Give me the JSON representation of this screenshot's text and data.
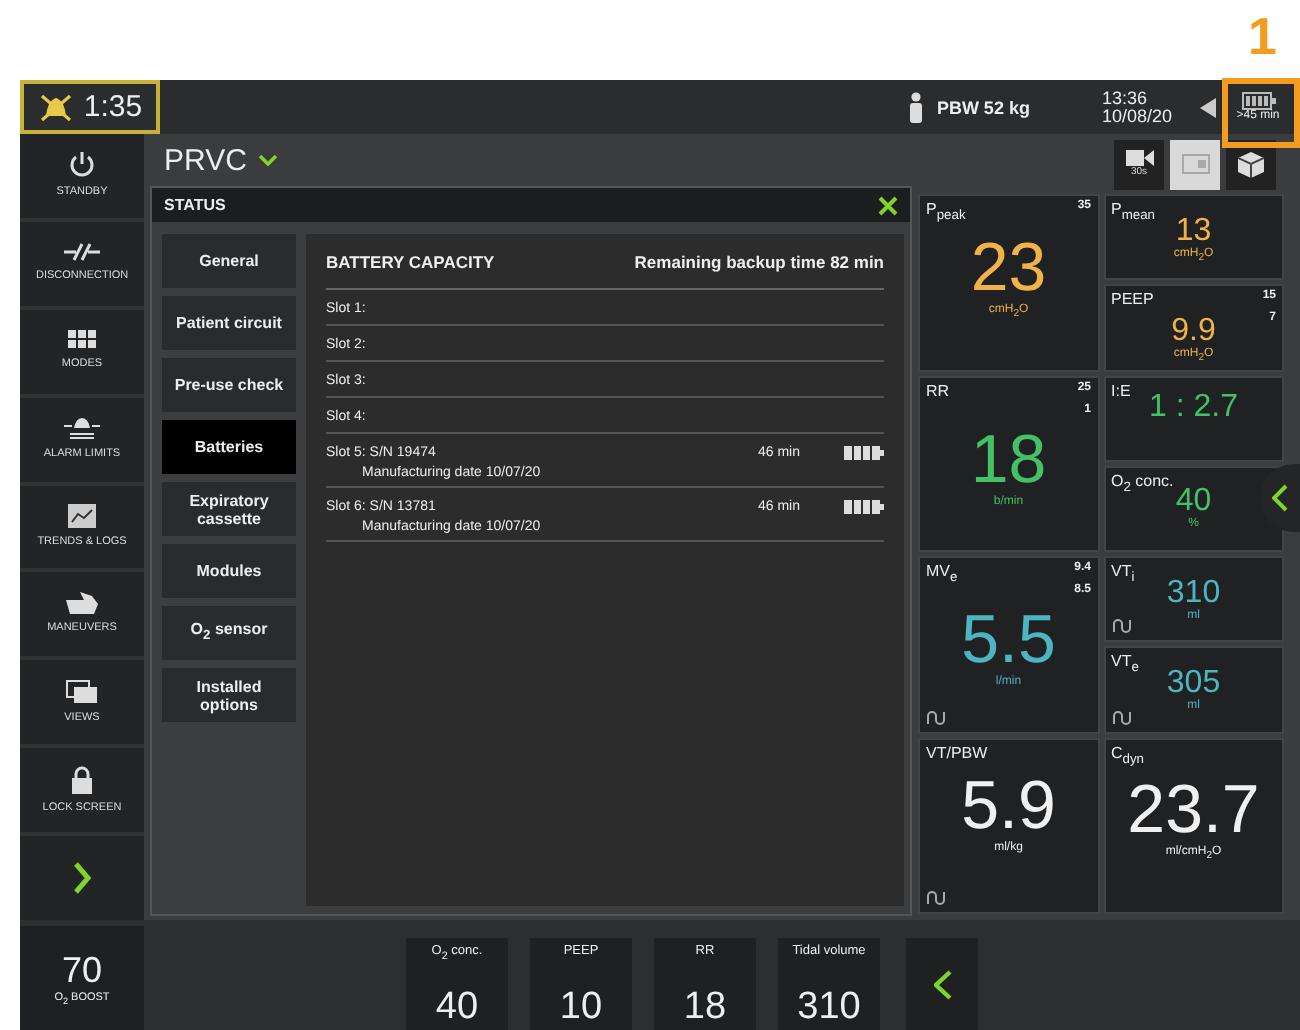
{
  "annotation": {
    "label": "1"
  },
  "top_bar": {
    "alarm_timer": "1:35",
    "patient": "PBW 52 kg",
    "time": "13:36",
    "date": "10/08/20",
    "battery": ">45 min"
  },
  "sidebar": {
    "items": [
      {
        "kind": "standby",
        "label": "STANDBY"
      },
      {
        "kind": "disconnection",
        "label": "DISCONNECTION"
      },
      {
        "kind": "modes",
        "label": "MODES"
      },
      {
        "kind": "alarm_limits",
        "label": "ALARM LIMITS"
      },
      {
        "kind": "trends",
        "label": "TRENDS & LOGS"
      },
      {
        "kind": "maneuvers",
        "label": "MANEUVERS"
      },
      {
        "kind": "views",
        "label": "VIEWS"
      },
      {
        "kind": "lock",
        "label": "LOCK SCREEN"
      },
      {
        "kind": "expand"
      }
    ]
  },
  "mode": "PRVC",
  "view_buttons": [
    {
      "kind": "record",
      "label": "30s",
      "selected": false
    },
    {
      "kind": "tile",
      "selected": true
    },
    {
      "kind": "cube",
      "selected": false
    }
  ],
  "status": {
    "title": "STATUS",
    "tabs": [
      {
        "label": "General",
        "selected": false
      },
      {
        "label": "Patient circuit",
        "selected": false
      },
      {
        "label": "Pre-use check",
        "selected": false
      },
      {
        "label": "Batteries",
        "selected": true
      },
      {
        "label": "Expiratory cassette",
        "selected": false
      },
      {
        "label": "Modules",
        "selected": false
      },
      {
        "label": "O$_{2}$ sensor",
        "selected": false
      },
      {
        "label": "Installed options",
        "selected": false
      }
    ],
    "heading": "BATTERY CAPACITY",
    "remaining": "Remaining backup time 82 min",
    "slots": [
      {
        "label": "Slot 1:"
      },
      {
        "label": "Slot 2:"
      },
      {
        "label": "Slot 3:"
      },
      {
        "label": "Slot 4:"
      },
      {
        "label": "Slot 5: S/N 19474",
        "time": "46 min",
        "date": "Manufacturing date 10/07/20"
      },
      {
        "label": "Slot 6: S/N 13781",
        "time": "46 min",
        "date": "Manufacturing date 10/07/20"
      }
    ]
  },
  "metric_rows": [
    {
      "main": {
        "kind": "large",
        "name": "P$_{peak}$",
        "upper": "35",
        "value": "23",
        "unit": "cmH$_{2}$O",
        "color": "#f2b24a",
        "waveform": false
      },
      "side": [
        {
          "kind": "small",
          "name": "P$_{mean}$",
          "value": "13",
          "unit": "cmH$_{2}$O",
          "color": "#f2b24a",
          "waveform": false
        },
        {
          "kind": "small",
          "name": "PEEP",
          "upper": "15",
          "lower": "7",
          "value": "9.9",
          "unit": "cmH$_{2}$O",
          "color": "#f2b24a",
          "waveform": false
        }
      ]
    },
    {
      "main": {
        "kind": "large",
        "name": "RR",
        "upper": "25",
        "lower": "1",
        "value": "18",
        "unit": "b/min",
        "color": "#44c066",
        "waveform": false
      },
      "side": [
        {
          "kind": "small",
          "name": "I:E",
          "value": "1 : 2.7",
          "color": "#44c066",
          "waveform": false
        },
        {
          "kind": "small",
          "name": "O$_{2}$ conc.",
          "value": "40",
          "unit": "%",
          "color": "#44c066",
          "waveform": false
        }
      ]
    },
    {
      "main": {
        "kind": "large",
        "name": "MV$_{e}$",
        "upper": "9.4",
        "lower": "8.5",
        "value": "5.5",
        "unit": "l/min",
        "color": "#4db5c1",
        "waveform": true
      },
      "side": [
        {
          "kind": "small",
          "name": "VT$_{i}$",
          "value": "310",
          "unit": "ml",
          "color": "#4db5c1",
          "waveform": true
        },
        {
          "kind": "small",
          "name": "VT$_{e}$",
          "value": "305",
          "unit": "ml",
          "color": "#4db5c1",
          "waveform": true
        }
      ]
    },
    {
      "main": {
        "kind": "large",
        "name": "VT/PBW",
        "value": "5.9",
        "unit": "ml/kg",
        "color": "#f0f0f0",
        "waveform": true
      },
      "side": [
        {
          "kind": "large",
          "name": "C$_{dyn}$",
          "value": "23.7",
          "unit": "ml/cmH$_{2}$O",
          "color": "#f0f0f0",
          "waveform": false
        }
      ]
    }
  ],
  "bottom_bar": {
    "boost": {
      "value": "70",
      "label": "O$_{2}$ BOOST"
    },
    "settings": [
      {
        "label": "O$_{2}$ conc.",
        "value": "40"
      },
      {
        "label": "PEEP",
        "value": "10"
      },
      {
        "label": "RR",
        "value": "18"
      },
      {
        "label": "Tidal volume",
        "value": "310"
      }
    ]
  }
}
